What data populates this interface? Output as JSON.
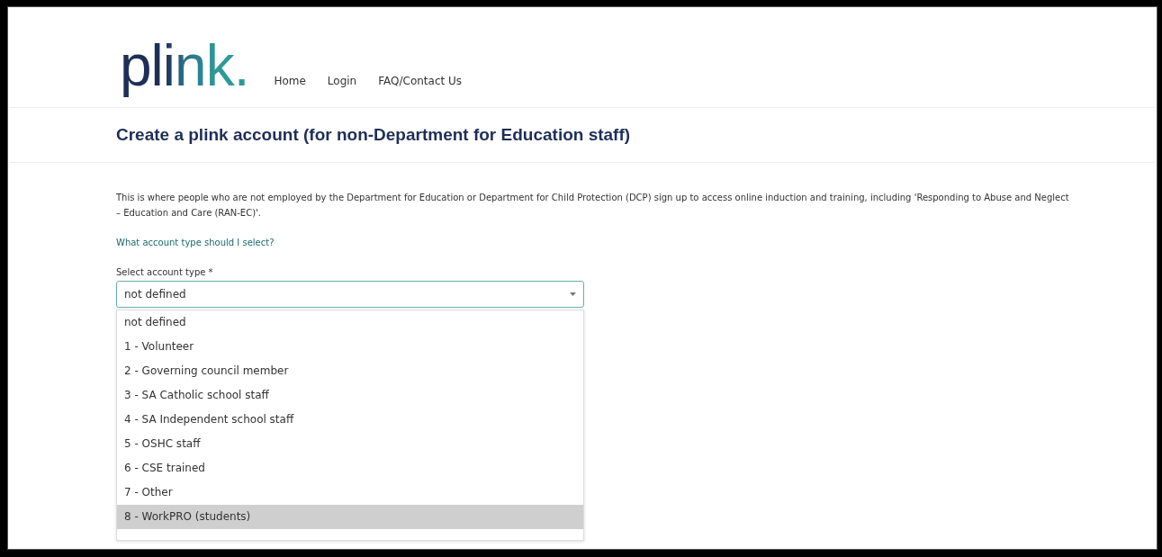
{
  "header": {
    "logo": "plink.",
    "nav": [
      {
        "label": "Home"
      },
      {
        "label": "Login"
      },
      {
        "label": "FAQ/Contact Us"
      }
    ]
  },
  "page_title": "Create a plink account (for non-Department for Education staff)",
  "intro": "This is where people who are not employed by the Department for Education or Department for Child Protection (DCP) sign up to access online induction and training, including 'Responding to Abuse and Neglect – Education and Care (RAN-EC)'.",
  "help_link": "What account type should I select?",
  "account_type": {
    "label": "Select account type *",
    "value": "not defined",
    "expanded": true,
    "options": [
      {
        "label": "not defined",
        "highlighted": false
      },
      {
        "label": "1 - Volunteer",
        "highlighted": false
      },
      {
        "label": "2 - Governing council member",
        "highlighted": false
      },
      {
        "label": "3 - SA Catholic school staff",
        "highlighted": false
      },
      {
        "label": "4 - SA Independent school staff",
        "highlighted": false
      },
      {
        "label": "5 - OSHC staff",
        "highlighted": false
      },
      {
        "label": "6 - CSE trained",
        "highlighted": false
      },
      {
        "label": "7 - Other",
        "highlighted": false
      },
      {
        "label": "8 - WorkPRO (students)",
        "highlighted": true
      }
    ]
  }
}
